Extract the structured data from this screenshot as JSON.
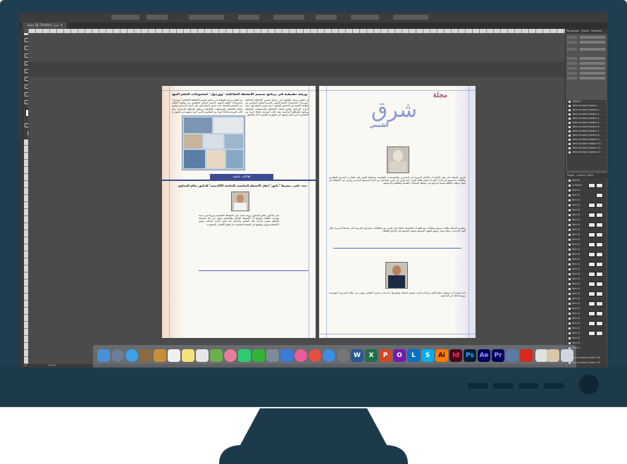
{
  "window": {
    "doc_tab": "ﺑﺘﺮﺍ ﺑـ٥٥٥٥% @ مجلة ×"
  },
  "left_page": {
    "headline": "ورشة تطبيقية في برنامج تصميم الأنشطة التفاعلية \"ووردول\" لمجموعات التعلم المهني بالتربية",
    "body_intro": "تم تنظيم ورشة تطبيقية في برنامج تصميم الأنشطة التفاعلية \"ووردول\" لمجموعات التعلم المهني بالتربية لتمكين المعلمين من توظيف التقنية في الحصص الصفية، حيث تعرف المشاركون على أدوات البرنامج وطرق إنشاء الأنشطة والمسابقات التفاعلية وربطها بالمناهج الدراسية، وقد لاقت الورشة تفاعلاً كبيراً من المعلمين الذين أبدوا رغبتهم في تطبيق ما تعلموه داخل الفصول.",
    "banner": "لقاءات علمية",
    "interview_headline": "بحث علمي ينشرها \"دكتور\" لنقل الأنشطة التعليمية بالجامعة الأكاديمية\" للدكتور صالح السناوي",
    "interview_body": "قدم الدكتور صالح السناوي ورقة بحثية حول الأنشطة التعليمية ودورها في تنمية مهارات الطلبة، وأوضح أن الأنشطة الصفية واللاصفية تسهم في بناء شخصية المتعلم وتعزيز قدراته على التفكير والإبداع، كما تناول البحث أساليب تقويم الأنشطة وطرق توظيفها في العملية التعليمية بما يحقق الأهداف المنشودة."
  },
  "right_page": {
    "logo_title": "مجلة",
    "logo_mark": "شرق",
    "logo_sub": "الشمس",
    "body_1": "تحرص المجلة على نشر الإنجازات والأخبار التربوية في المدارس والمؤسسات التعليمية، وتسليط الضوء على التجارب المميزة للمعلمين والطلبة، بما يسهم في تبادل الخبرات ونشر ثقافة التميز. كما تهدف إلى تعزيز التواصل بين أفراد المجتمع المدرسي وإبراز دور الأنشطة في صقل مواهب الطلبة وتنمية قدراتهم في مختلف المجالات العلمية والثقافية والرياضية.",
    "body_2": "وتتضمن المجلة مقالات تربوية ومقابلات مع القيادات التعليمية، إضافة إلى تقارير عن الفعاليات والبرامج التدريبية التي تنفذها المديرية خلال العام الدراسي، وذلك بهدف توثيق الجهود المبذولة وتحفيز الجميع على الإبداع والعطاء.",
    "body_3": "كما يسعدنا أن نستقبل مشاركاتكم وآراءكم لإثراء محتوى المجلة وتطويرها بما يخدم مسيرة التعليم، ويعزز من مكانة المدرسة كمؤسسة تربوية فاعلة في المجتمع."
  },
  "panels": {
    "tabs": [
      "Paragraph",
      "Stroke",
      "Gradient"
    ],
    "pages_tabs": [
      "Pages",
      "Layers",
      "Links"
    ],
    "swatch_header": "[None]",
    "swatches": [
      "New Gradient Swatch",
      "New Gradient Swatch 2",
      "New Gradient Swatch 3",
      "New Gradient Swatch 4",
      "New Gradient Swatch 5",
      "New Gradient Swatch 6",
      "New Gradient Swatch 7",
      "New Gradient Swatch 8",
      "New Gradient Swatch 9",
      "New Gradient Swatch 10",
      "New Gradient Swatch 11",
      "New Gradient Swatch 12"
    ],
    "pages": [
      "[None]",
      "A-Master",
      "New Gr",
      "New Gr",
      "New Gr",
      "New Gr",
      "New Gr",
      "New Gr",
      "New Gr",
      "New Gr",
      "New Gr",
      "New Gr",
      "New Gr",
      "New Gr",
      "New Gr",
      "New Gr",
      "New Gr",
      "New Gr",
      "New Gr",
      "New Gr",
      "New Gr",
      "New Gr",
      "New Gr",
      "New Gr",
      "New Gr",
      "New Gr",
      "New Gr",
      "New Gr",
      "New Gr",
      "New Gr",
      "New Gr",
      "New Gr",
      "New Gr",
      "New Gr",
      "New Gr"
    ],
    "bottom_swatches": [
      "New Gradient Swatch 28",
      "New Gradient Swatch 29"
    ]
  },
  "status": {
    "page_number": "١٥",
    "zoom": "١٩٧.٩%"
  },
  "dock": {
    "app_letters": [
      "W",
      "X",
      "P",
      "O",
      "L",
      "S",
      "Ai",
      "Id",
      "Ps",
      "Ae",
      "Pr"
    ]
  },
  "colors": {
    "monitor_bezel": "#1f3e4f",
    "banner_blue": "#3d4a94",
    "logo_rose": "#a3556a",
    "logo_blue": "#8a9ad4"
  }
}
